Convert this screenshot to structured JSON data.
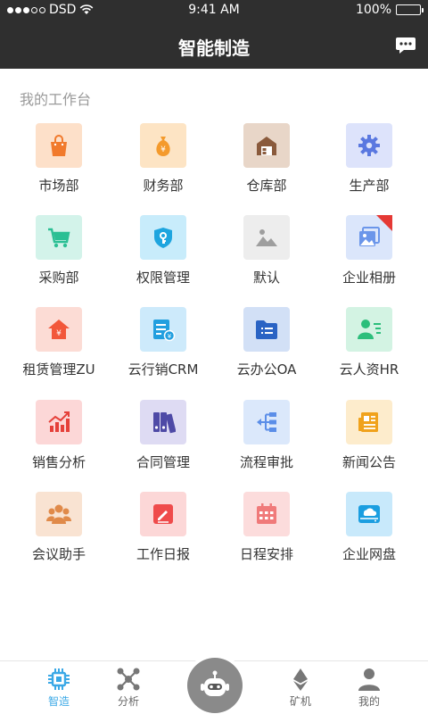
{
  "status_bar": {
    "carrier": "DSD",
    "time": "9:41 AM",
    "battery": "100%"
  },
  "nav": {
    "title": "智能制造",
    "chat_icon": "chat-bubble-icon"
  },
  "section_title": "我的工作台",
  "apps": [
    {
      "label": "市场部",
      "icon": "shopping-bag-icon",
      "tile_color": "#fde0c9",
      "icon_color": "#f17a2c"
    },
    {
      "label": "财务部",
      "icon": "money-bag-icon",
      "tile_color": "#fde4c4",
      "icon_color": "#f49a2c"
    },
    {
      "label": "仓库部",
      "icon": "warehouse-icon",
      "tile_color": "#e8d6c8",
      "icon_color": "#8a5a3c"
    },
    {
      "label": "生产部",
      "icon": "gear-icon",
      "tile_color": "#dde3fb",
      "icon_color": "#5a78e0"
    },
    {
      "label": "采购部",
      "icon": "cart-icon",
      "tile_color": "#d3f3ea",
      "icon_color": "#2bbf94"
    },
    {
      "label": "权限管理",
      "icon": "shield-key-icon",
      "tile_color": "#c8ecfb",
      "icon_color": "#1ea5df"
    },
    {
      "label": "默认",
      "icon": "image-icon",
      "tile_color": "#ededed",
      "icon_color": "#9e9e9e"
    },
    {
      "label": "企业相册",
      "icon": "album-icon",
      "tile_color": "#dbe6fb",
      "icon_color": "#6b96ea",
      "badge": true
    },
    {
      "label": "租赁管理ZU",
      "icon": "house-money-icon",
      "tile_color": "#fcdcd5",
      "icon_color": "#f2573a"
    },
    {
      "label": "云行销CRM",
      "icon": "crm-doc-icon",
      "tile_color": "#cdeafb",
      "icon_color": "#229fdf"
    },
    {
      "label": "云办公OA",
      "icon": "folder-icon",
      "tile_color": "#d2e0f6",
      "icon_color": "#2a63c4"
    },
    {
      "label": "云人资HR",
      "icon": "person-list-icon",
      "tile_color": "#d3f3e3",
      "icon_color": "#2bbe7b"
    },
    {
      "label": "销售分析",
      "icon": "bar-chart-icon",
      "tile_color": "#fcd7d7",
      "icon_color": "#e5403a"
    },
    {
      "label": "合同管理",
      "icon": "binders-icon",
      "tile_color": "#dedbf3",
      "icon_color": "#4e4aa6"
    },
    {
      "label": "流程审批",
      "icon": "flow-icon",
      "tile_color": "#dbe8fb",
      "icon_color": "#5b8ee8"
    },
    {
      "label": "新闻公告",
      "icon": "newspaper-icon",
      "tile_color": "#fdeccc",
      "icon_color": "#f0a21c"
    },
    {
      "label": "会议助手",
      "icon": "meeting-icon",
      "tile_color": "#f9e3d2",
      "icon_color": "#e08a4a"
    },
    {
      "label": "工作日报",
      "icon": "edit-note-icon",
      "tile_color": "#fcd7d7",
      "icon_color": "#ef4b4b"
    },
    {
      "label": "日程安排",
      "icon": "calendar-icon",
      "tile_color": "#fcdcdc",
      "icon_color": "#f07a7a"
    },
    {
      "label": "企业网盘",
      "icon": "cloud-drive-icon",
      "tile_color": "#c8e9fb",
      "icon_color": "#1b9ee0"
    }
  ],
  "tabs": [
    {
      "label": "智造",
      "icon": "chip-icon",
      "active": true
    },
    {
      "label": "分析",
      "icon": "network-icon",
      "active": false
    },
    {
      "label": "矿机",
      "icon": "ethereum-icon",
      "active": false
    },
    {
      "label": "我的",
      "icon": "user-icon",
      "active": false
    }
  ],
  "center_button_icon": "robot-icon",
  "colors": {
    "header_bg": "#2f2f2f",
    "accent": "#3aa8e6",
    "tab_inactive": "#666666"
  }
}
